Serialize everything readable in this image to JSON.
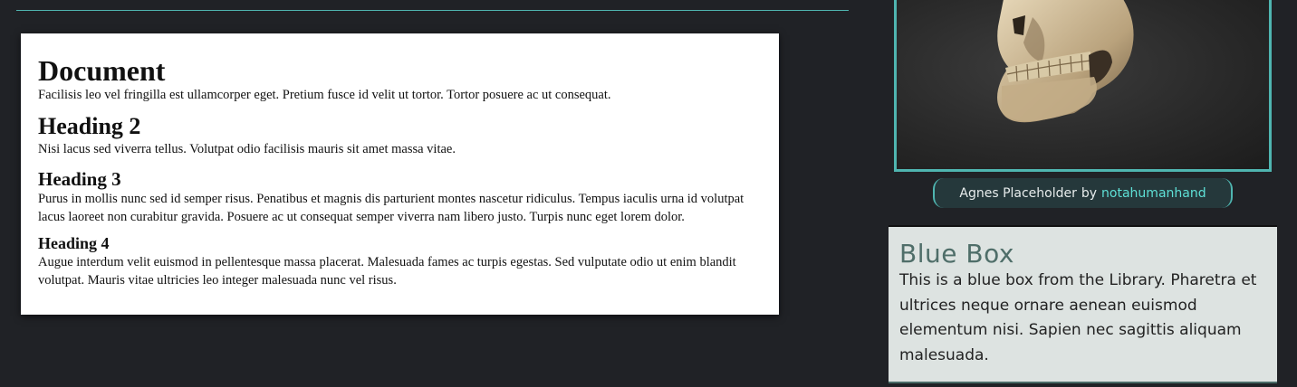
{
  "document": {
    "title": "Document",
    "intro": "Facilisis leo vel fringilla est ullamcorper eget. Pretium fusce id velit ut tortor. Tortor posuere ac ut consequat.",
    "h2": "Heading 2",
    "p2": "Nisi lacus sed viverra tellus. Volutpat odio facilisis mauris sit amet massa vitae.",
    "h3": "Heading 3",
    "p3": "Purus in mollis nunc sed id semper risus. Penatibus et magnis dis parturient montes nascetur ridiculus. Tempus iaculis urna id volutpat lacus laoreet non curabitur gravida. Posuere ac ut consequat semper viverra nam libero justo. Turpis nunc eget lorem dolor.",
    "h4": "Heading 4",
    "p4": "Augue interdum velit euismod in pellentesque massa placerat. Malesuada fames ac turpis egestas. Sed vulputate odio ut enim blandit volutpat. Mauris vitae ultricies leo integer malesuada nunc vel risus."
  },
  "image": {
    "caption_name": "Agnes Placeholder",
    "caption_by": "by",
    "caption_author": "notahumanhand"
  },
  "blue_box": {
    "title": "Blue Box",
    "body": "This is a blue box from the Library. Pharetra et ultrices neque ornare aenean euismod elementum nisi. Sapien nec sagittis aliquam malesuada."
  },
  "colors": {
    "background": "#202226",
    "accent": "#4fb5b0",
    "link": "#5ee0d6",
    "blue_box_bg": "#dde3e1",
    "blue_box_title": "#4f6e69"
  }
}
